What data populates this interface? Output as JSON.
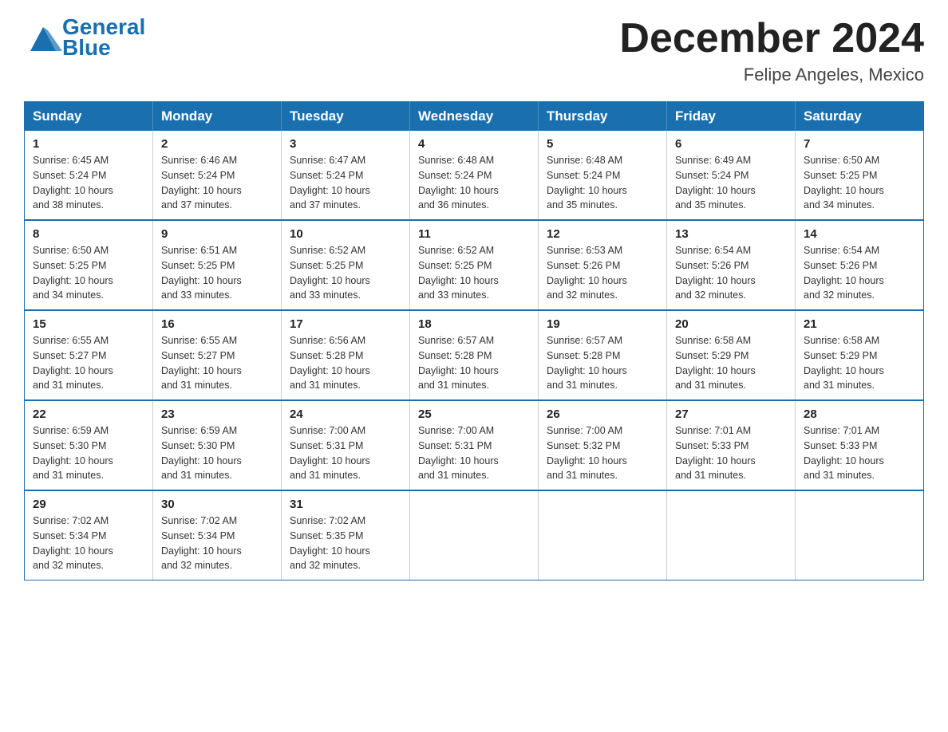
{
  "header": {
    "logo_general": "General",
    "logo_blue": "Blue",
    "title": "December 2024",
    "subtitle": "Felipe Angeles, Mexico"
  },
  "days_of_week": [
    "Sunday",
    "Monday",
    "Tuesday",
    "Wednesday",
    "Thursday",
    "Friday",
    "Saturday"
  ],
  "weeks": [
    [
      {
        "day": "1",
        "sunrise": "6:45 AM",
        "sunset": "5:24 PM",
        "daylight": "10 hours and 38 minutes."
      },
      {
        "day": "2",
        "sunrise": "6:46 AM",
        "sunset": "5:24 PM",
        "daylight": "10 hours and 37 minutes."
      },
      {
        "day": "3",
        "sunrise": "6:47 AM",
        "sunset": "5:24 PM",
        "daylight": "10 hours and 37 minutes."
      },
      {
        "day": "4",
        "sunrise": "6:48 AM",
        "sunset": "5:24 PM",
        "daylight": "10 hours and 36 minutes."
      },
      {
        "day": "5",
        "sunrise": "6:48 AM",
        "sunset": "5:24 PM",
        "daylight": "10 hours and 35 minutes."
      },
      {
        "day": "6",
        "sunrise": "6:49 AM",
        "sunset": "5:24 PM",
        "daylight": "10 hours and 35 minutes."
      },
      {
        "day": "7",
        "sunrise": "6:50 AM",
        "sunset": "5:25 PM",
        "daylight": "10 hours and 34 minutes."
      }
    ],
    [
      {
        "day": "8",
        "sunrise": "6:50 AM",
        "sunset": "5:25 PM",
        "daylight": "10 hours and 34 minutes."
      },
      {
        "day": "9",
        "sunrise": "6:51 AM",
        "sunset": "5:25 PM",
        "daylight": "10 hours and 33 minutes."
      },
      {
        "day": "10",
        "sunrise": "6:52 AM",
        "sunset": "5:25 PM",
        "daylight": "10 hours and 33 minutes."
      },
      {
        "day": "11",
        "sunrise": "6:52 AM",
        "sunset": "5:25 PM",
        "daylight": "10 hours and 33 minutes."
      },
      {
        "day": "12",
        "sunrise": "6:53 AM",
        "sunset": "5:26 PM",
        "daylight": "10 hours and 32 minutes."
      },
      {
        "day": "13",
        "sunrise": "6:54 AM",
        "sunset": "5:26 PM",
        "daylight": "10 hours and 32 minutes."
      },
      {
        "day": "14",
        "sunrise": "6:54 AM",
        "sunset": "5:26 PM",
        "daylight": "10 hours and 32 minutes."
      }
    ],
    [
      {
        "day": "15",
        "sunrise": "6:55 AM",
        "sunset": "5:27 PM",
        "daylight": "10 hours and 31 minutes."
      },
      {
        "day": "16",
        "sunrise": "6:55 AM",
        "sunset": "5:27 PM",
        "daylight": "10 hours and 31 minutes."
      },
      {
        "day": "17",
        "sunrise": "6:56 AM",
        "sunset": "5:28 PM",
        "daylight": "10 hours and 31 minutes."
      },
      {
        "day": "18",
        "sunrise": "6:57 AM",
        "sunset": "5:28 PM",
        "daylight": "10 hours and 31 minutes."
      },
      {
        "day": "19",
        "sunrise": "6:57 AM",
        "sunset": "5:28 PM",
        "daylight": "10 hours and 31 minutes."
      },
      {
        "day": "20",
        "sunrise": "6:58 AM",
        "sunset": "5:29 PM",
        "daylight": "10 hours and 31 minutes."
      },
      {
        "day": "21",
        "sunrise": "6:58 AM",
        "sunset": "5:29 PM",
        "daylight": "10 hours and 31 minutes."
      }
    ],
    [
      {
        "day": "22",
        "sunrise": "6:59 AM",
        "sunset": "5:30 PM",
        "daylight": "10 hours and 31 minutes."
      },
      {
        "day": "23",
        "sunrise": "6:59 AM",
        "sunset": "5:30 PM",
        "daylight": "10 hours and 31 minutes."
      },
      {
        "day": "24",
        "sunrise": "7:00 AM",
        "sunset": "5:31 PM",
        "daylight": "10 hours and 31 minutes."
      },
      {
        "day": "25",
        "sunrise": "7:00 AM",
        "sunset": "5:31 PM",
        "daylight": "10 hours and 31 minutes."
      },
      {
        "day": "26",
        "sunrise": "7:00 AM",
        "sunset": "5:32 PM",
        "daylight": "10 hours and 31 minutes."
      },
      {
        "day": "27",
        "sunrise": "7:01 AM",
        "sunset": "5:33 PM",
        "daylight": "10 hours and 31 minutes."
      },
      {
        "day": "28",
        "sunrise": "7:01 AM",
        "sunset": "5:33 PM",
        "daylight": "10 hours and 31 minutes."
      }
    ],
    [
      {
        "day": "29",
        "sunrise": "7:02 AM",
        "sunset": "5:34 PM",
        "daylight": "10 hours and 32 minutes."
      },
      {
        "day": "30",
        "sunrise": "7:02 AM",
        "sunset": "5:34 PM",
        "daylight": "10 hours and 32 minutes."
      },
      {
        "day": "31",
        "sunrise": "7:02 AM",
        "sunset": "5:35 PM",
        "daylight": "10 hours and 32 minutes."
      },
      null,
      null,
      null,
      null
    ]
  ],
  "labels": {
    "sunrise": "Sunrise:",
    "sunset": "Sunset:",
    "daylight": "Daylight:"
  }
}
